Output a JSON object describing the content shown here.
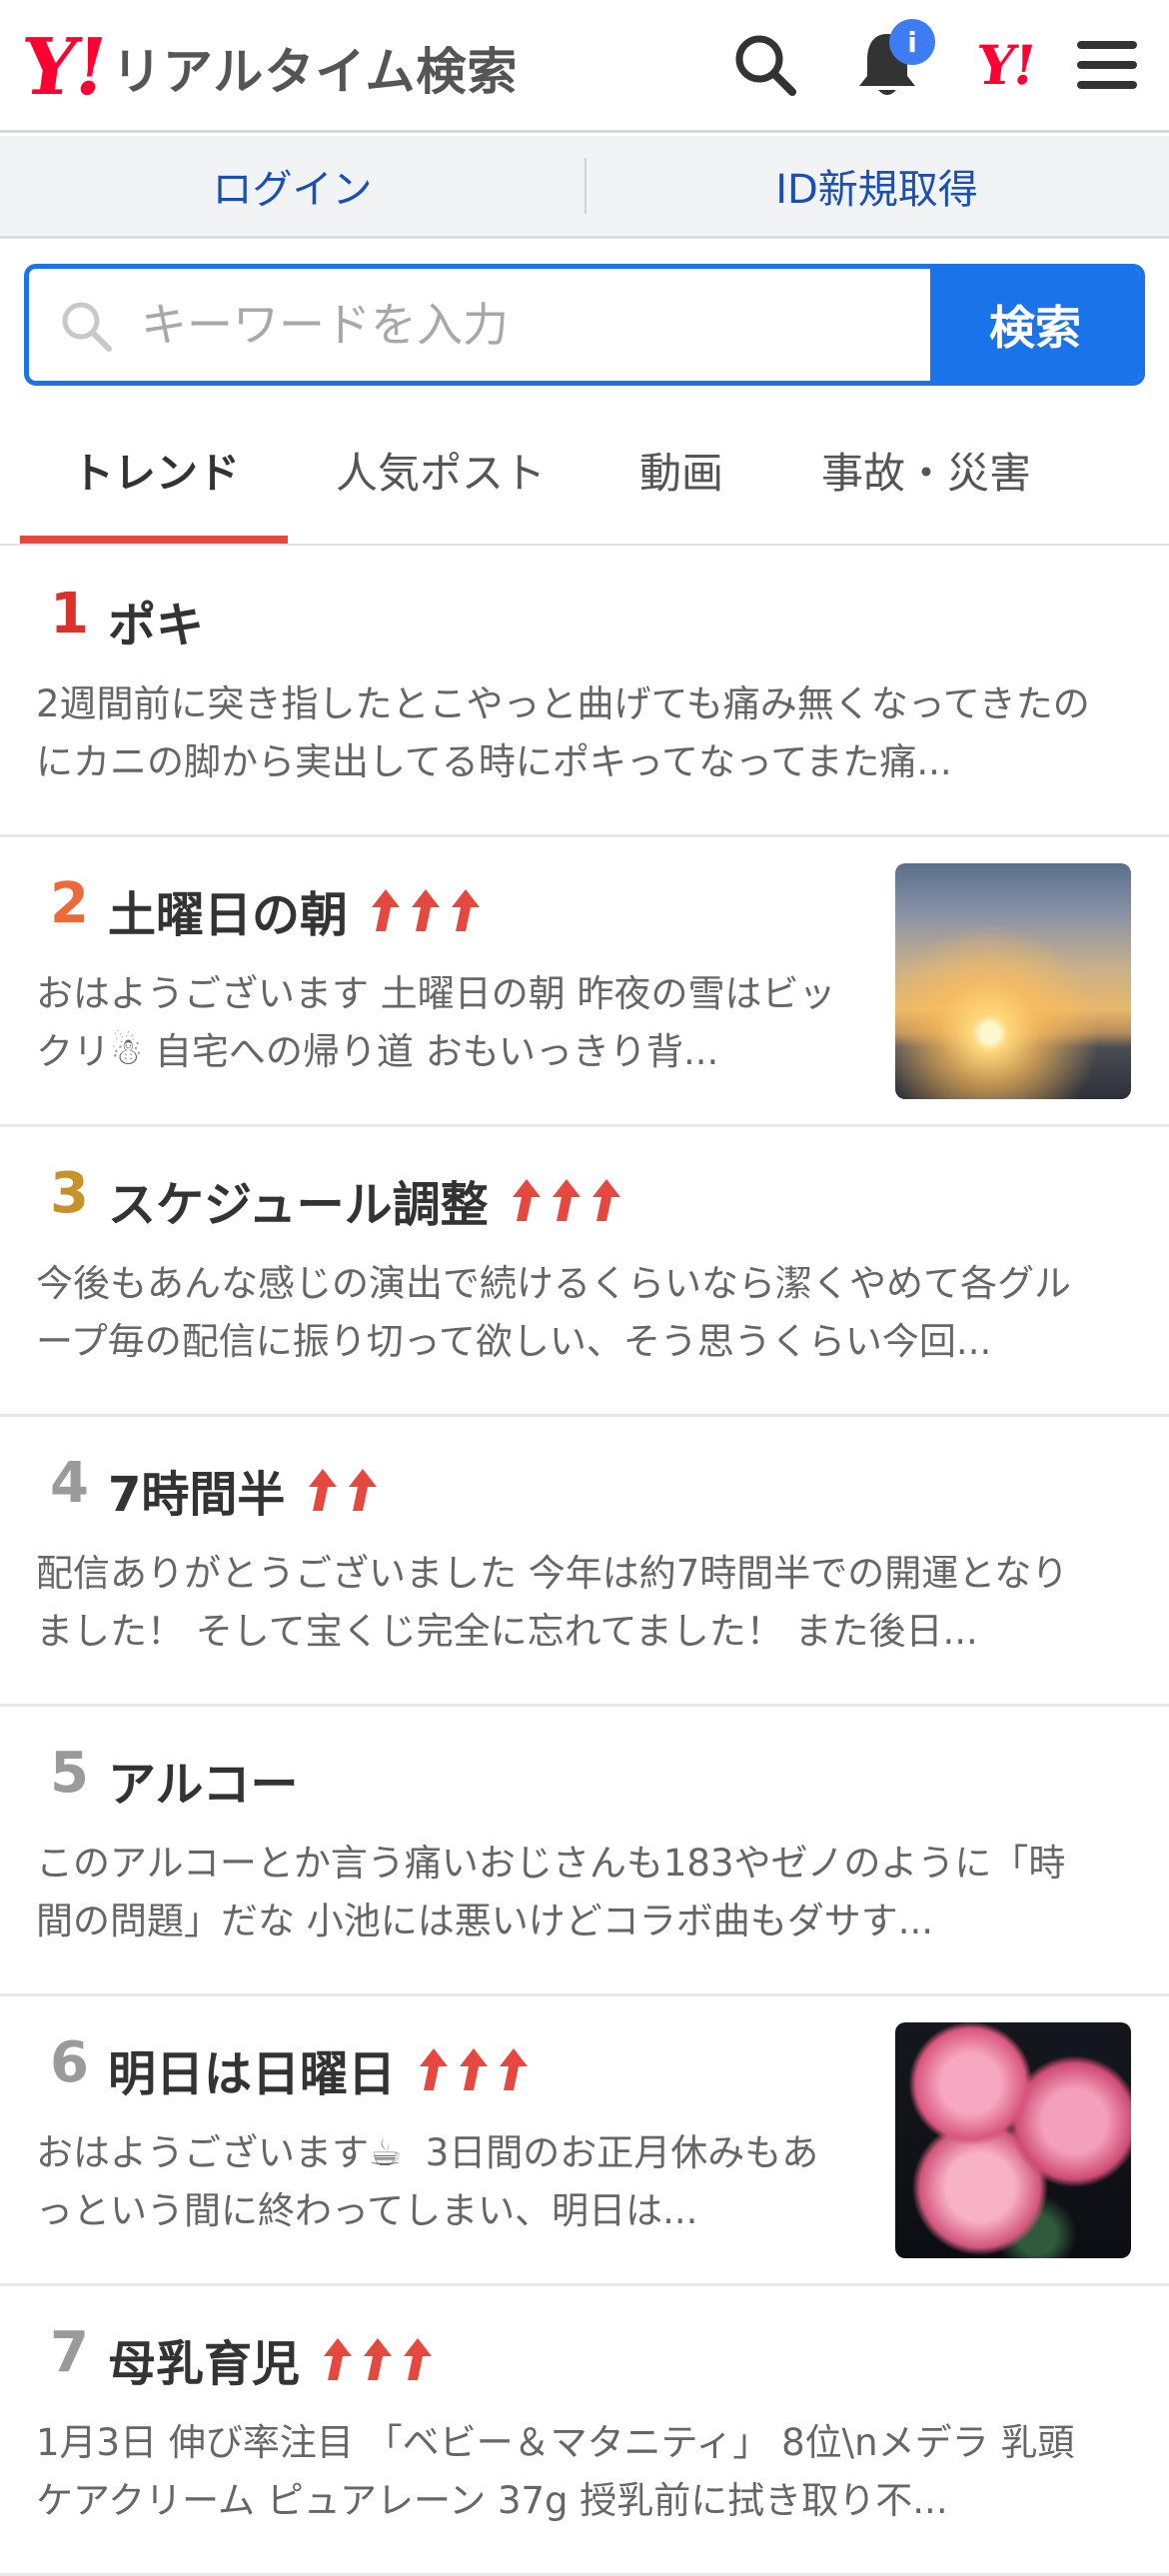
{
  "header": {
    "logo_y": "Y!",
    "logo_text": "リアルタイム検索",
    "notification_badge": "i",
    "yj_logo": "Y!",
    "icons": [
      "search-icon",
      "bell-icon",
      "yahoo-japan-icon",
      "hamburger-menu-icon"
    ]
  },
  "login_bar": {
    "login": "ログイン",
    "register": "ID新規取得"
  },
  "search": {
    "placeholder": "キーワードを入力",
    "button": "検索"
  },
  "tabs": [
    {
      "label": "トレンド",
      "active": true
    },
    {
      "label": "人気ポスト",
      "active": false
    },
    {
      "label": "動画",
      "active": false
    },
    {
      "label": "事故・災害",
      "active": false
    }
  ],
  "colors": {
    "accent_blue": "#1a73e8",
    "rank_1": "#d8322a",
    "rank_2": "#ec6a3a",
    "rank_3": "#c8922a",
    "rank_other": "#9a9a9a",
    "trend_arrow": "#e5483f"
  },
  "trends": [
    {
      "rank": "1",
      "title": "ポキ",
      "arrows": 0,
      "thumbnail": null,
      "desc": "2週間前に突き指したとこやっと曲げても痛み無くなってきたのにカニの脚から実出してる時にポキってなってまた痛..."
    },
    {
      "rank": "2",
      "title": "土曜日の朝",
      "arrows": 3,
      "thumbnail": "sunset-photo",
      "desc": "おはようございます󠄀 土曜日の朝 昨夜の雪はビックリ☃ 自宅への帰り道 おもいっきり背..."
    },
    {
      "rank": "3",
      "title": "スケジュール調整",
      "arrows": 3,
      "thumbnail": null,
      "desc": "今後もあんな感じの演出で続けるくらいなら潔くやめて各グループ毎の配信に振り切って欲しい、そう思うくらい今回..."
    },
    {
      "rank": "4",
      "title": "7時間半",
      "arrows": 2,
      "thumbnail": null,
      "desc": "配信ありがとうございました 今年は約7時間半での開運となりました！ そして宝くじ完全に忘れてました！ また後日..."
    },
    {
      "rank": "5",
      "title": "アルコー",
      "arrows": 0,
      "thumbnail": null,
      "desc": "このアルコーとか言う痛いおじさんも183やゼノのように「時間の問題」だな 小池には悪いけどコラボ曲もダサす..."
    },
    {
      "rank": "6",
      "title": "明日は日曜日",
      "arrows": 3,
      "thumbnail": "peony-photo",
      "desc": "おはようございます☕󠄀 󠄀󠄀󠄀 3日間のお正月休みもあっという間に終わってしまい、明日は..."
    },
    {
      "rank": "7",
      "title": "母乳育児",
      "arrows": 3,
      "thumbnail": null,
      "desc": "󠄀1月3日 伸び率注目 「ベビー＆マタニティ」 8位\\nメデラ 乳頭ケアクリーム ピュアレーン 37g 授乳前に拭き取り不..."
    }
  ]
}
